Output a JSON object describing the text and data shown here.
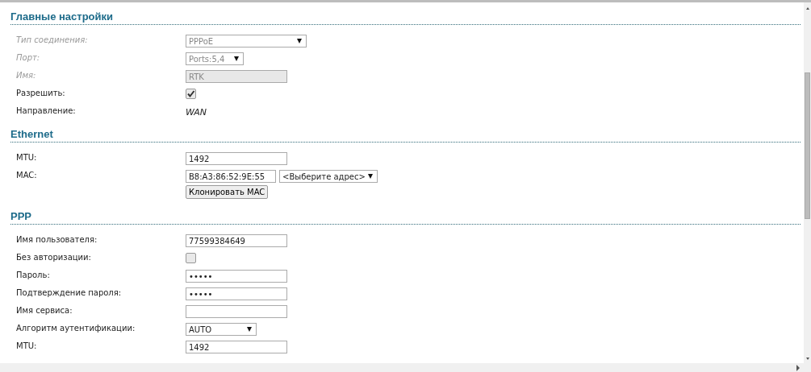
{
  "sections": [
    {
      "title": "Главные настройки",
      "rows": [
        {
          "label": "Тип соединения:",
          "disabled": true,
          "kind": "select",
          "value": "PPPoE"
        },
        {
          "label": "Порт:",
          "disabled": true,
          "kind": "select",
          "value": "Ports:5,4"
        },
        {
          "label": "Имя:",
          "disabled": true,
          "kind": "input",
          "value": "RTK"
        },
        {
          "label": "Разрешить:",
          "disabled": false,
          "kind": "checkbox",
          "checked": true
        },
        {
          "label": "Направление:",
          "disabled": false,
          "kind": "text",
          "value": "WAN"
        }
      ]
    },
    {
      "title": "Ethernet",
      "rows": [
        {
          "label": "MTU:",
          "disabled": false,
          "kind": "input",
          "value": "1492"
        },
        {
          "label": "MAC:",
          "disabled": false,
          "kind": "mac",
          "value": "B8:A3:86:52:9E:55",
          "select_value": "<Выберите адрес>",
          "button": "Клонировать MAC"
        }
      ]
    },
    {
      "title": "PPP",
      "rows": [
        {
          "label": "Имя пользователя:",
          "disabled": false,
          "kind": "input",
          "value": "77599384649"
        },
        {
          "label": "Без авторизации:",
          "disabled": false,
          "kind": "checkbox",
          "checked": false
        },
        {
          "label": "Пароль:",
          "disabled": false,
          "kind": "input",
          "value": "•••••"
        },
        {
          "label": "Подтверждение пароля:",
          "disabled": false,
          "kind": "input",
          "value": "•••••"
        },
        {
          "label": "Имя сервиса:",
          "disabled": false,
          "kind": "input"
        },
        {
          "label": "Алгоритм аутентификации:",
          "disabled": false,
          "kind": "select",
          "value": "AUTO"
        },
        {
          "label": "MTU:",
          "disabled": false,
          "kind": "input",
          "value": "1492"
        }
      ]
    }
  ]
}
